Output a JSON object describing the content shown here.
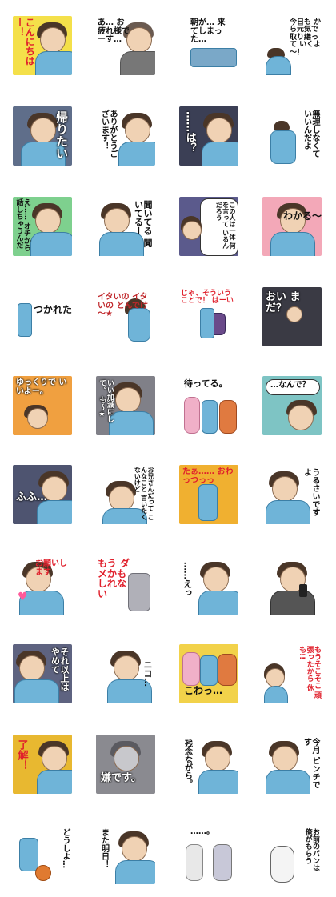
{
  "stickers": [
    {
      "caption": "こんにちはー！",
      "bg": "#f4e04a"
    },
    {
      "caption": "あ… お疲れ様でーす…",
      "bg": "#ffffff"
    },
    {
      "caption": "朝が… 来てしまった…",
      "bg": "#ffffff"
    },
    {
      "caption": "今日も から元気で 取り繕って いくよ～！",
      "bg": "#ffffff"
    },
    {
      "caption": "帰りたい",
      "bg": "#5f6e8a"
    },
    {
      "caption": "ありがとうございます！",
      "bg": "#ffffff"
    },
    {
      "caption": "……は？",
      "bg": "#3b3f55"
    },
    {
      "caption": "無理しなくて いいんだよ",
      "bg": "#ffffff"
    },
    {
      "caption": "え…… オチから話しちゃうんだ",
      "bg": "#7ed08e"
    },
    {
      "caption": "聞いてる 聞いてるー",
      "bg": "#ffffff"
    },
    {
      "caption": "この人は一体 何を言って いるんだろう",
      "bg": "#5b5a8c"
    },
    {
      "caption": "わかる～",
      "bg": "#f3a8b8"
    },
    {
      "caption": "つかれた",
      "bg": "#ffffff"
    },
    {
      "caption": "イタいの イタいの とんでけ～★",
      "bg": "#ffffff"
    },
    {
      "caption": "じゃ、そういうことで！ はーい",
      "bg": "#ffffff"
    },
    {
      "caption": "おい まだ？",
      "bg": "#3a3a44"
    },
    {
      "caption": "ゆっくりで いいよー。",
      "bg": "#f0a040"
    },
    {
      "caption": "いい加減にして。 も～★",
      "bg": "#808088"
    },
    {
      "caption": "待ってる。",
      "bg": "#ffffff"
    },
    {
      "caption": "…なんで？",
      "bg": "#7ec4c4"
    },
    {
      "caption": "ふふ…",
      "bg": "#4e5470"
    },
    {
      "caption": "お兄さんだって こんなこと 言いたくないけど",
      "bg": "#ffffff"
    },
    {
      "caption": "たぁ…… おわっつっっ",
      "bg": "#f0b030"
    },
    {
      "caption": "うるさいですよ",
      "bg": "#ffffff"
    },
    {
      "caption": "お願いします",
      "bg": "#ffffff"
    },
    {
      "caption": "もう ダメかも しれない",
      "bg": "#ffffff"
    },
    {
      "caption": "……えっ",
      "bg": "#ffffff"
    },
    {
      "caption": "",
      "bg": "#ffffff"
    },
    {
      "caption": "それ以上は やめて",
      "bg": "#5e6380"
    },
    {
      "caption": "ニコ…",
      "bg": "#ffffff"
    },
    {
      "caption": "こわっ…",
      "bg": "#f2d24a"
    },
    {
      "caption": "もうそこそこ 頑張ったから 休も!!",
      "bg": "#ffffff"
    },
    {
      "caption": "了解！",
      "bg": "#e8b830"
    },
    {
      "caption": "嫌です。",
      "bg": "#8a8a90"
    },
    {
      "caption": "残念ながら。",
      "bg": "#ffffff"
    },
    {
      "caption": "今月 ピンチです",
      "bg": "#ffffff"
    },
    {
      "caption": "どうしよ…",
      "bg": "#ffffff"
    },
    {
      "caption": "また明日！",
      "bg": "#ffffff"
    },
    {
      "caption": "……。",
      "bg": "#ffffff"
    },
    {
      "caption": "お前のパンは 俺がもらう",
      "bg": "#ffffff"
    }
  ]
}
